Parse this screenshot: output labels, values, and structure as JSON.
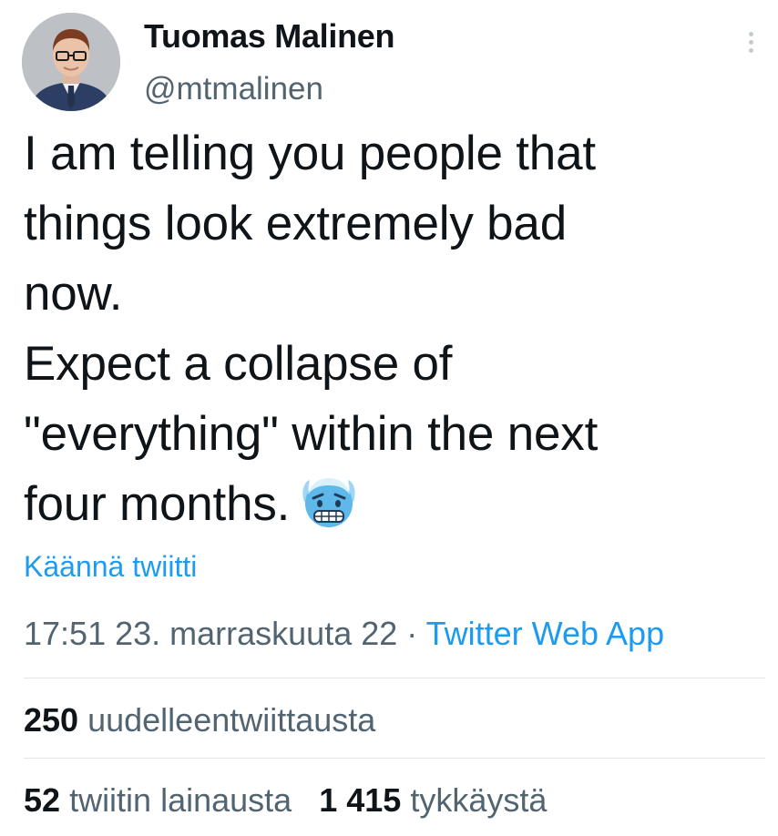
{
  "author": {
    "display_name": "Tuomas Malinen",
    "handle": "@mtmalinen"
  },
  "tweet": {
    "lines": [
      "I am telling you people that",
      "things look extremely bad",
      "now.",
      "Expect a collapse of",
      "\"everything\" within the next",
      "four months."
    ],
    "emoji_icon": "cold-face-emoji-icon"
  },
  "translate_label": "Käännä twiitti",
  "meta": {
    "timestamp": "17:51 23. marraskuuta 22",
    "separator": "·",
    "source": "Twitter Web App"
  },
  "stats": {
    "retweets": {
      "count": "250",
      "label": "uudelleentwiittausta"
    },
    "quotes": {
      "count": "52",
      "label": "twiitin lainausta"
    },
    "likes": {
      "count": "1 415",
      "label": "tykkäystä"
    }
  },
  "colors": {
    "accent": "#1d9bf0",
    "secondary_text": "#536471",
    "primary_text": "#0f1419",
    "divider": "#e1e6ea"
  }
}
